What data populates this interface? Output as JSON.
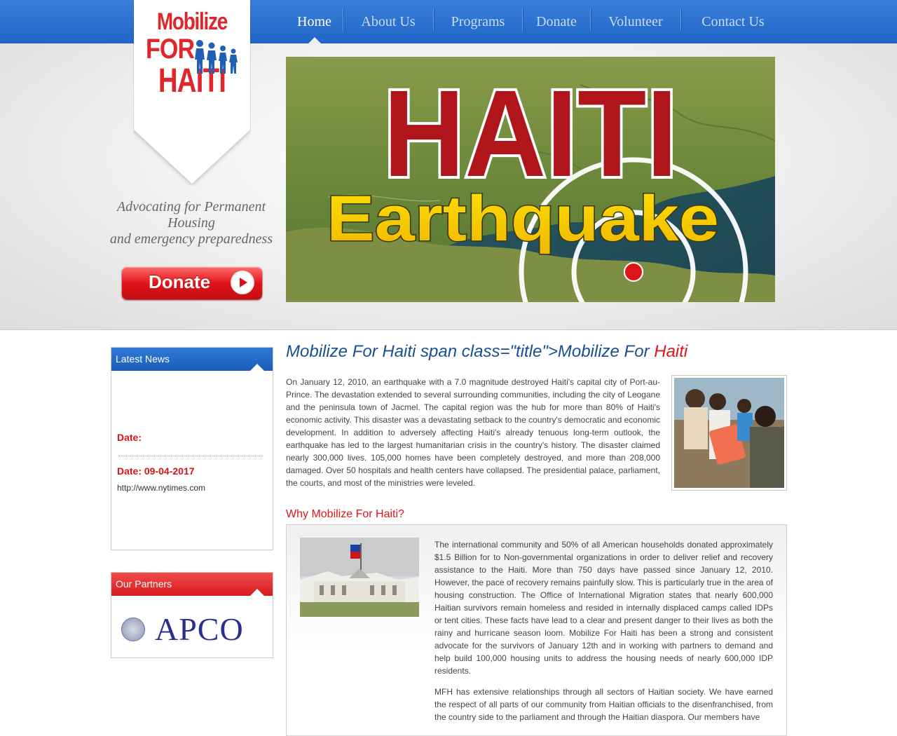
{
  "nav": {
    "items": [
      "Home",
      "About Us",
      "Programs",
      "Donate",
      "Volunteer",
      "Contact Us"
    ],
    "active": "Home"
  },
  "logo": {
    "line1": "Mobilize",
    "line2": "FOR",
    "line3": "HAITI"
  },
  "tagline": {
    "line1": "Advocating for Permanent",
    "line2": "Housing",
    "line3": "and emergency preparedness"
  },
  "donate_button": {
    "label": "Donate"
  },
  "banner": {
    "title": "HAITI",
    "subtitle": "Earthquake"
  },
  "latest_news": {
    "heading": "Latest News",
    "item1_date": "Date:",
    "item2_date": "Date: 09-04-2017",
    "item2_link": "http://www.nytimes.com"
  },
  "partners": {
    "heading": "Our Partners",
    "logo_text": "APCO"
  },
  "main": {
    "title_prefix": "Mobilize For Haiti span class=\"title\">Mobilize For ",
    "title_highlight": "Haiti",
    "intro": "On January 12, 2010, an earthquake with a 7.0 magnitude destroyed Haiti's capital city of Port-au-Prince. The devastation extended to several surrounding communities, including the city of Leogane and the peninsula town of Jacmel. The capital region was the hub for more than 80% of Haiti's economic activity. This disaster was a devastating setback to the country's democratic and economic development. In addition to adversely affecting Haiti's already tenuous long-term outlook, the earthquake has led to the largest humanitarian crisis in the country's history. The disaster claimed nearly 300,000 lives. 105,000 homes have been completely destroyed, and more than 208,000 damaged. Over 50 hospitals and health centers have collapsed. The presidential palace, parliament, the courts, and most of the ministries were leveled.",
    "why_heading": "Why Mobilize For Haiti?",
    "why_para1": "The international community and 50% of all American households donated approximately $1.5 Billion for to Non-governmental organizations in order to deliver relief and recovery assistance to the Haiti. More than 750 days have passed since January 12, 2010. However, the pace of recovery remains painfully slow. This is particularly true in the area of housing construction. The Office of International Migration states that nearly 600,000 Haitian survivors remain homeless and resided in internally displaced camps called IDPs or tent cities. These facts have lead to a clear and present danger to their lives as both the rainy and hurricane season loom. Mobilize For Haiti has been a strong and consistent advocate for the survivors of January 12th and in working with partners to demand and help build 100,000 housing units to address the housing needs of nearly 600,000 IDP residents.",
    "why_para2": "MFH has extensive relationships through all sectors of Haitian society. We have earned the respect of all parts of our community from Haitian officials to the disenfranchised, from the country side to the parliament and through the Haitian diaspora. Our members have"
  },
  "colors": {
    "nav_blue": "#1f66c7",
    "brand_red": "#e0141a",
    "title_blue": "#1a4f8f"
  }
}
